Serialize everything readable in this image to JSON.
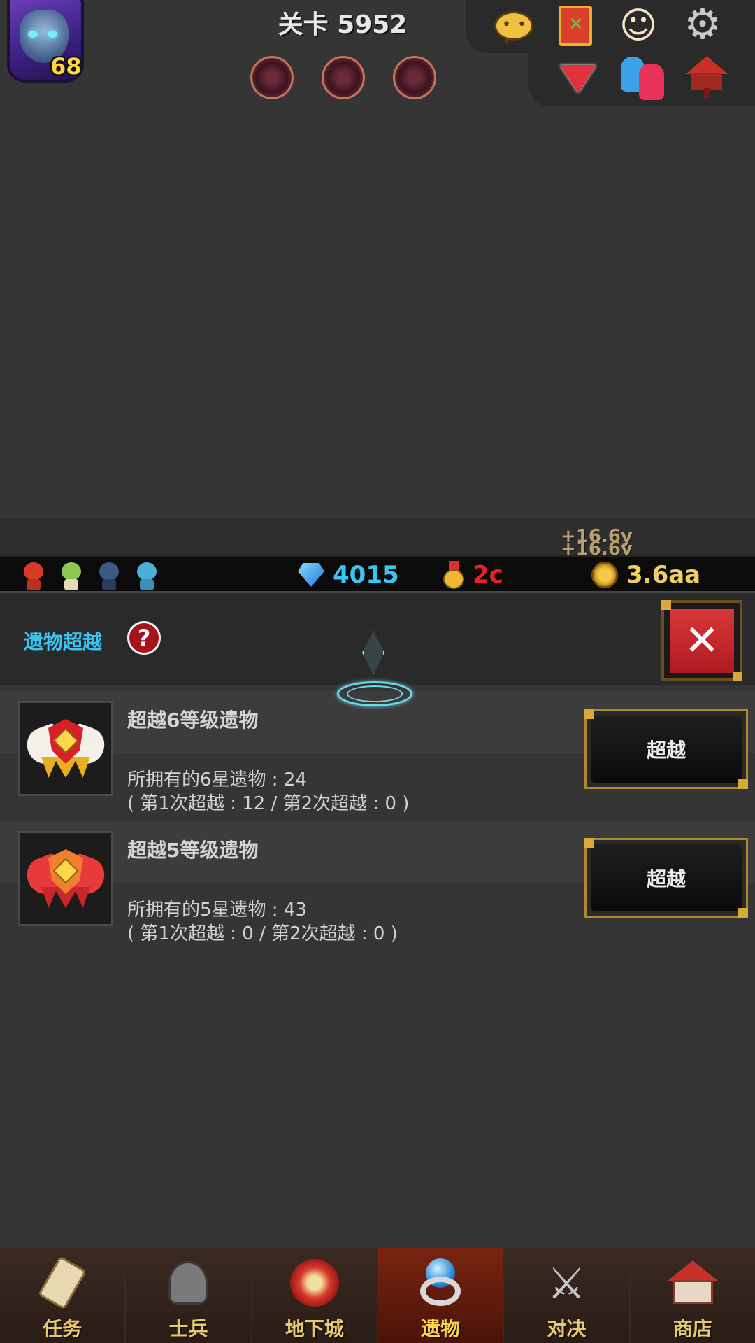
{
  "hud": {
    "player_level": "68",
    "stage_title": "关卡 5952",
    "orb_count": 3,
    "icons": [
      "chat-icon",
      "guild-banner-icon",
      "angel-icon",
      "gear-icon",
      "dropdown-triangle-icon",
      "friends-icon",
      "mailbox-icon"
    ]
  },
  "resources": {
    "floating_bonus_1": "+16.6y",
    "floating_bonus_2": "+16.6y",
    "diamonds": "4015",
    "medals": "2c",
    "gold": "3.6aa",
    "colors": {
      "diamonds": "#3cc4f0",
      "medals": "#e8202a",
      "gold": "#f0d060"
    }
  },
  "panel": {
    "title": "遗物超越",
    "help_label": "?",
    "close_label": "✕"
  },
  "rows": [
    {
      "title": "超越6等级遗物",
      "owned": "所拥有的6星遗物 : 24",
      "detail": "( 第1次超越 : 12 / 第2次超越 : 0 )",
      "button": "超越",
      "emblem_color": "gold"
    },
    {
      "title": "超越5等级遗物",
      "owned": "所拥有的5星遗物 : 43",
      "detail": "( 第1次超越 : 0 / 第2次超越 :  0 )",
      "button": "超越",
      "emblem_color": "red"
    }
  ],
  "nav": [
    {
      "label": "任务",
      "icon": "scroll-icon"
    },
    {
      "label": "士兵",
      "icon": "soldier-icon"
    },
    {
      "label": "地下城",
      "icon": "monster-flower-icon"
    },
    {
      "label": "遗物",
      "icon": "relic-orb-icon",
      "active": true
    },
    {
      "label": "对决",
      "icon": "crossed-swords-icon"
    },
    {
      "label": "商店",
      "icon": "shop-icon"
    }
  ]
}
